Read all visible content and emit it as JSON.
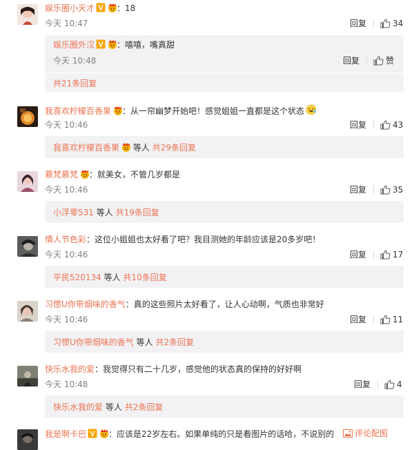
{
  "comments": [
    {
      "user": "娱乐圈小天才",
      "text": "：18",
      "time": "今天 10:47",
      "reply": "回复",
      "likes": "34",
      "avatar_color": "#c94a3a",
      "sub": {
        "user": "娱乐圈外汉",
        "text": "：嘻嘻，嘴真甜",
        "time": "今天 10:48",
        "reply": "回复",
        "likes": "赞"
      },
      "more": "共21条回复"
    },
    {
      "user": "我喜欢柠檬百香果",
      "text": "：从一帘幽梦开始吧！感觉姐姐一直都是这个状态",
      "time": "今天 10:46",
      "reply": "回复",
      "likes": "43",
      "avatar_color": "#a05a2c",
      "more_user": "我喜欢柠檬百香果",
      "more_mid": "等人",
      "more": "共29条回复"
    },
    {
      "user": "慕梵慕梵",
      "text": "：就美女，不管几岁都是",
      "time": "今天 10:46",
      "reply": "回复",
      "likes": "35",
      "avatar_color": "#b88ea0",
      "more_user": "小浮零531",
      "more_mid": "等人",
      "more": "共19条回复"
    },
    {
      "user": "情人节色彩",
      "text": "：这位小姐姐也太好看了吧？我目测她的年龄应该是20多岁吧！",
      "time": "今天 10:46",
      "reply": "回复",
      "likes": "17",
      "avatar_color": "#6b6b6b",
      "more_user": "平民520134",
      "more_mid": "等人",
      "more": "共10条回复"
    },
    {
      "user": "习惯U你带烟味的香气",
      "text": "：真的这些照片太好看了，让人心动啊，气质也非常好",
      "time": "今天 10:46",
      "reply": "回复",
      "likes": "11",
      "avatar_color": "#8d8a86",
      "more_user": "习惯U你带烟味的香气",
      "more_mid": "等人",
      "more": "共2条回复"
    },
    {
      "user": "快乐水我的爱",
      "text": "：我觉得只有二十几岁，感觉他的状态真的保持的好好啊",
      "time": "今天 10:48",
      "reply": "回复",
      "likes": "4",
      "avatar_color": "#5a5e55",
      "more_user": "快乐水我的爱",
      "more_mid": "等人",
      "more": "共2条回复"
    },
    {
      "user": "我是啊卡巴",
      "text": "：应该是22岁左右。如果单纯的只是看图片的话哈，不说别的",
      "avatar_color": "#3a3a3a"
    }
  ],
  "bottom_bar": {
    "label": "评论配图"
  }
}
